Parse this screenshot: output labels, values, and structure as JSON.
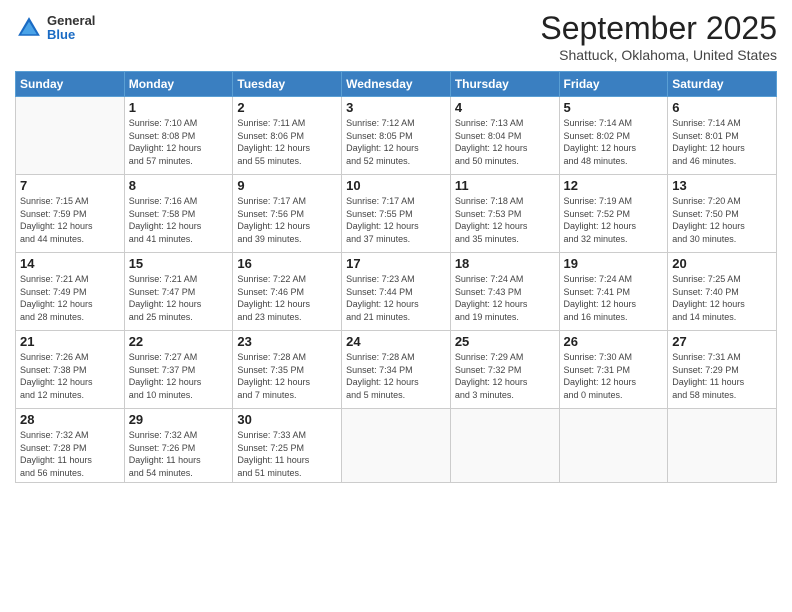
{
  "header": {
    "logo": {
      "general": "General",
      "blue": "Blue"
    },
    "title": "September 2025",
    "subtitle": "Shattuck, Oklahoma, United States"
  },
  "weekdays": [
    "Sunday",
    "Monday",
    "Tuesday",
    "Wednesday",
    "Thursday",
    "Friday",
    "Saturday"
  ],
  "weeks": [
    [
      {
        "day": "",
        "info": ""
      },
      {
        "day": "1",
        "info": "Sunrise: 7:10 AM\nSunset: 8:08 PM\nDaylight: 12 hours\nand 57 minutes."
      },
      {
        "day": "2",
        "info": "Sunrise: 7:11 AM\nSunset: 8:06 PM\nDaylight: 12 hours\nand 55 minutes."
      },
      {
        "day": "3",
        "info": "Sunrise: 7:12 AM\nSunset: 8:05 PM\nDaylight: 12 hours\nand 52 minutes."
      },
      {
        "day": "4",
        "info": "Sunrise: 7:13 AM\nSunset: 8:04 PM\nDaylight: 12 hours\nand 50 minutes."
      },
      {
        "day": "5",
        "info": "Sunrise: 7:14 AM\nSunset: 8:02 PM\nDaylight: 12 hours\nand 48 minutes."
      },
      {
        "day": "6",
        "info": "Sunrise: 7:14 AM\nSunset: 8:01 PM\nDaylight: 12 hours\nand 46 minutes."
      }
    ],
    [
      {
        "day": "7",
        "info": "Sunrise: 7:15 AM\nSunset: 7:59 PM\nDaylight: 12 hours\nand 44 minutes."
      },
      {
        "day": "8",
        "info": "Sunrise: 7:16 AM\nSunset: 7:58 PM\nDaylight: 12 hours\nand 41 minutes."
      },
      {
        "day": "9",
        "info": "Sunrise: 7:17 AM\nSunset: 7:56 PM\nDaylight: 12 hours\nand 39 minutes."
      },
      {
        "day": "10",
        "info": "Sunrise: 7:17 AM\nSunset: 7:55 PM\nDaylight: 12 hours\nand 37 minutes."
      },
      {
        "day": "11",
        "info": "Sunrise: 7:18 AM\nSunset: 7:53 PM\nDaylight: 12 hours\nand 35 minutes."
      },
      {
        "day": "12",
        "info": "Sunrise: 7:19 AM\nSunset: 7:52 PM\nDaylight: 12 hours\nand 32 minutes."
      },
      {
        "day": "13",
        "info": "Sunrise: 7:20 AM\nSunset: 7:50 PM\nDaylight: 12 hours\nand 30 minutes."
      }
    ],
    [
      {
        "day": "14",
        "info": "Sunrise: 7:21 AM\nSunset: 7:49 PM\nDaylight: 12 hours\nand 28 minutes."
      },
      {
        "day": "15",
        "info": "Sunrise: 7:21 AM\nSunset: 7:47 PM\nDaylight: 12 hours\nand 25 minutes."
      },
      {
        "day": "16",
        "info": "Sunrise: 7:22 AM\nSunset: 7:46 PM\nDaylight: 12 hours\nand 23 minutes."
      },
      {
        "day": "17",
        "info": "Sunrise: 7:23 AM\nSunset: 7:44 PM\nDaylight: 12 hours\nand 21 minutes."
      },
      {
        "day": "18",
        "info": "Sunrise: 7:24 AM\nSunset: 7:43 PM\nDaylight: 12 hours\nand 19 minutes."
      },
      {
        "day": "19",
        "info": "Sunrise: 7:24 AM\nSunset: 7:41 PM\nDaylight: 12 hours\nand 16 minutes."
      },
      {
        "day": "20",
        "info": "Sunrise: 7:25 AM\nSunset: 7:40 PM\nDaylight: 12 hours\nand 14 minutes."
      }
    ],
    [
      {
        "day": "21",
        "info": "Sunrise: 7:26 AM\nSunset: 7:38 PM\nDaylight: 12 hours\nand 12 minutes."
      },
      {
        "day": "22",
        "info": "Sunrise: 7:27 AM\nSunset: 7:37 PM\nDaylight: 12 hours\nand 10 minutes."
      },
      {
        "day": "23",
        "info": "Sunrise: 7:28 AM\nSunset: 7:35 PM\nDaylight: 12 hours\nand 7 minutes."
      },
      {
        "day": "24",
        "info": "Sunrise: 7:28 AM\nSunset: 7:34 PM\nDaylight: 12 hours\nand 5 minutes."
      },
      {
        "day": "25",
        "info": "Sunrise: 7:29 AM\nSunset: 7:32 PM\nDaylight: 12 hours\nand 3 minutes."
      },
      {
        "day": "26",
        "info": "Sunrise: 7:30 AM\nSunset: 7:31 PM\nDaylight: 12 hours\nand 0 minutes."
      },
      {
        "day": "27",
        "info": "Sunrise: 7:31 AM\nSunset: 7:29 PM\nDaylight: 11 hours\nand 58 minutes."
      }
    ],
    [
      {
        "day": "28",
        "info": "Sunrise: 7:32 AM\nSunset: 7:28 PM\nDaylight: 11 hours\nand 56 minutes."
      },
      {
        "day": "29",
        "info": "Sunrise: 7:32 AM\nSunset: 7:26 PM\nDaylight: 11 hours\nand 54 minutes."
      },
      {
        "day": "30",
        "info": "Sunrise: 7:33 AM\nSunset: 7:25 PM\nDaylight: 11 hours\nand 51 minutes."
      },
      {
        "day": "",
        "info": ""
      },
      {
        "day": "",
        "info": ""
      },
      {
        "day": "",
        "info": ""
      },
      {
        "day": "",
        "info": ""
      }
    ]
  ]
}
